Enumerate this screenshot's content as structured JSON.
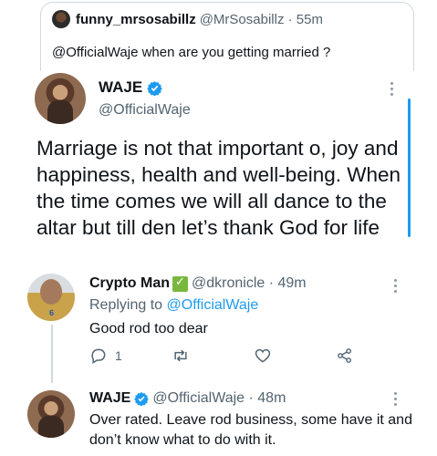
{
  "quote": {
    "name": "funny_mrsosabillz",
    "handle_time": "@MrSosabillz · 55m",
    "text": "@OfficialWaje when are you getting married ?"
  },
  "main_tweet": {
    "name": "WAJE",
    "handle": "@OfficialWaje",
    "text": "Marriage is not that important o, joy and happiness, health and well-being. When the time comes we will all dance to the altar but till den let’s thank God for life"
  },
  "reply1": {
    "name": "Crypto Man",
    "handle_time": "@dkronicle · 49m",
    "replying_prefix": "Replying to",
    "replying_to": "@OfficialWaje",
    "text": "Good rod too dear",
    "reply_count": "1"
  },
  "reply2": {
    "name": "WAJE",
    "handle_time": "@OfficialWaje · 48m",
    "text": "Over rated. Leave rod business, some have it and don’t know what to do with it."
  },
  "colors": {
    "accent": "#1d9bf0",
    "muted": "#536471",
    "text": "#0f1419"
  }
}
